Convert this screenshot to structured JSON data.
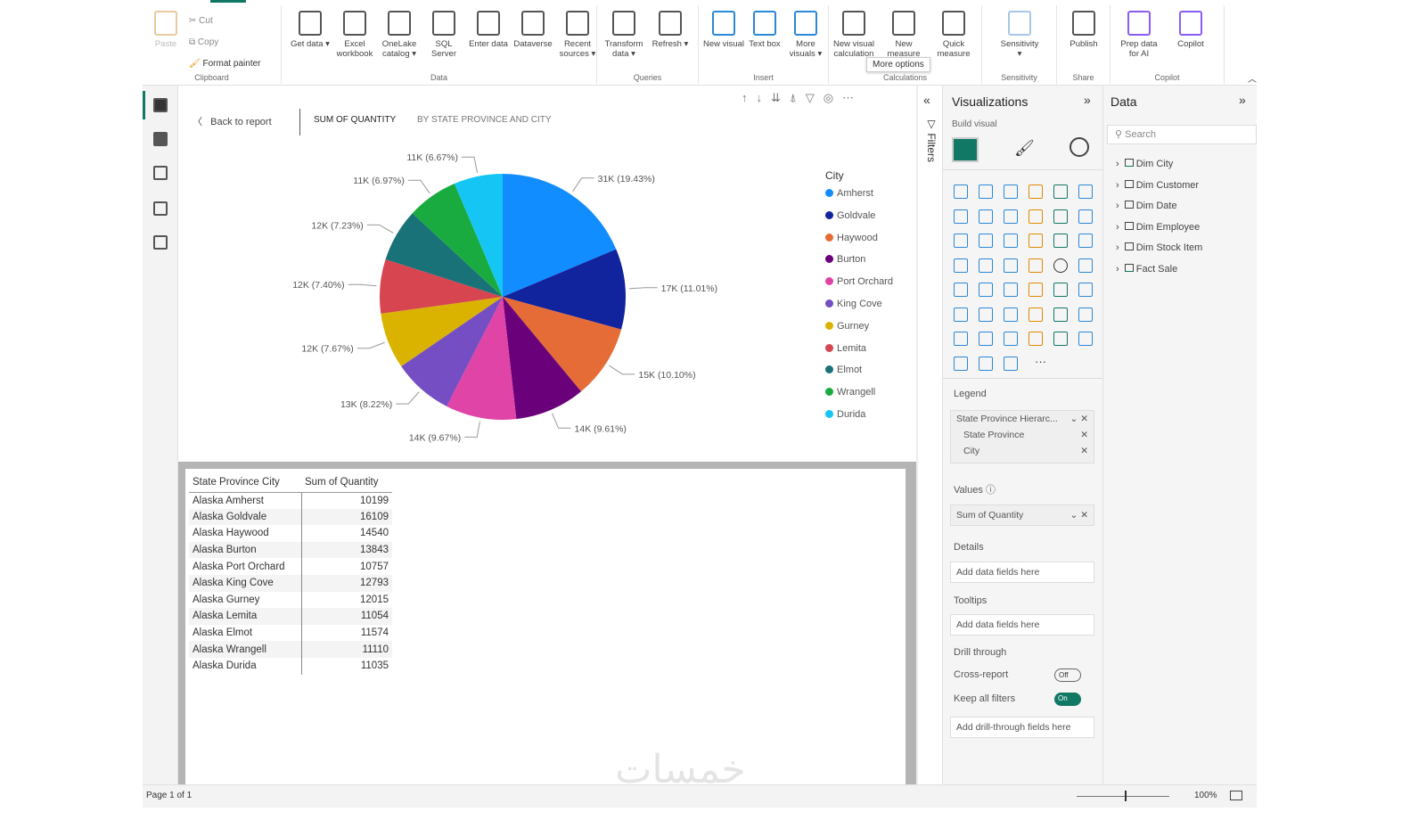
{
  "ribbon": {
    "clipboard": {
      "paste": "Paste",
      "cut": "Cut",
      "copy": "Copy",
      "format_painter": "Format painter",
      "group": "Clipboard"
    },
    "data": {
      "group": "Data",
      "buttons": [
        "Get data ▾",
        "Excel workbook",
        "OneLake catalog ▾",
        "SQL Server",
        "Enter data",
        "Dataverse",
        "Recent sources ▾"
      ]
    },
    "queries": {
      "group": "Queries",
      "buttons": [
        "Transform data ▾",
        "Refresh ▾"
      ]
    },
    "insert": {
      "group": "Insert",
      "buttons": [
        "New visual",
        "Text box",
        "More visuals ▾"
      ]
    },
    "calculations": {
      "group": "Calculations",
      "buttons": [
        "New visual calculation",
        "New measure",
        "Quick measure"
      ],
      "tooltip": "More options"
    },
    "sensitivity": {
      "group": "Sensitivity",
      "buttons": [
        "Sensitivity ▾"
      ]
    },
    "share": {
      "group": "Share",
      "buttons": [
        "Publish"
      ]
    },
    "copilot": {
      "group": "Copilot",
      "buttons": [
        "Prep data for AI",
        "Copilot"
      ]
    }
  },
  "header": {
    "back": "Back to report",
    "title": "SUM OF QUANTITY",
    "subtitle": "BY STATE PROVINCE AND CITY"
  },
  "chart_data": {
    "type": "pie",
    "legend_title": "City",
    "legend_position": "right",
    "categories": [
      "Amherst",
      "Goldvale",
      "Haywood",
      "Burton",
      "Port Orchard",
      "King Cove",
      "Gurney",
      "Lemita",
      "Elmot",
      "Wrangell",
      "Durida"
    ],
    "values": [
      19.43,
      11.01,
      10.1,
      9.61,
      9.67,
      8.22,
      7.67,
      7.4,
      7.23,
      6.97,
      6.67
    ],
    "labels": [
      "31K (19.43%)",
      "17K (11.01%)",
      "15K (10.10%)",
      "14K (9.61%)",
      "14K (9.67%)",
      "13K (8.22%)",
      "12K (7.67%)",
      "12K (7.40%)",
      "12K (7.23%)",
      "11K (6.97%)",
      "11K (6.67%)"
    ],
    "colors": [
      "#118dff",
      "#12239e",
      "#e66c37",
      "#6b007b",
      "#e044a7",
      "#744ec2",
      "#d9b300",
      "#d64550",
      "#197278",
      "#1aab40",
      "#15c6f4"
    ]
  },
  "table": {
    "headers": [
      "State Province  City",
      "Sum of Quantity"
    ],
    "rows": [
      [
        "Alaska  Amherst",
        "10199"
      ],
      [
        "Alaska  Goldvale",
        "16109"
      ],
      [
        "Alaska  Haywood",
        "14540"
      ],
      [
        "Alaska  Burton",
        "13843"
      ],
      [
        "Alaska  Port Orchard",
        "10757"
      ],
      [
        "Alaska  King Cove",
        "12793"
      ],
      [
        "Alaska  Gurney",
        "12015"
      ],
      [
        "Alaska  Lemita",
        "11054"
      ],
      [
        "Alaska  Elmot",
        "11574"
      ],
      [
        "Alaska  Wrangell",
        "11110"
      ],
      [
        "Alaska  Durida",
        "11035"
      ]
    ]
  },
  "filters": {
    "label": "Filters"
  },
  "viz": {
    "title": "Visualizations",
    "build": "Build visual",
    "legend_label": "Legend",
    "legend_fields": [
      "State Province Hierarc...",
      "State Province",
      "City"
    ],
    "values_label": "Values",
    "values_field": "Sum of Quantity",
    "details_label": "Details",
    "details_placeholder": "Add data fields here",
    "tooltips_label": "Tooltips",
    "tooltips_placeholder": "Add data fields here",
    "drill_label": "Drill through",
    "cross_report": "Cross-report",
    "cross_state": "Off",
    "keep_filters": "Keep all filters",
    "keep_state": "On",
    "drill_placeholder": "Add drill-through fields here",
    "more": "···"
  },
  "data_pane": {
    "title": "Data",
    "search_placeholder": "Search",
    "tables": [
      "Dim City",
      "Dim Customer",
      "Dim Date",
      "Dim Employee",
      "Dim Stock Item",
      "Fact Sale"
    ]
  },
  "status": {
    "page": "Page 1 of 1",
    "zoom": "100%",
    "zoom_percent": 100
  }
}
